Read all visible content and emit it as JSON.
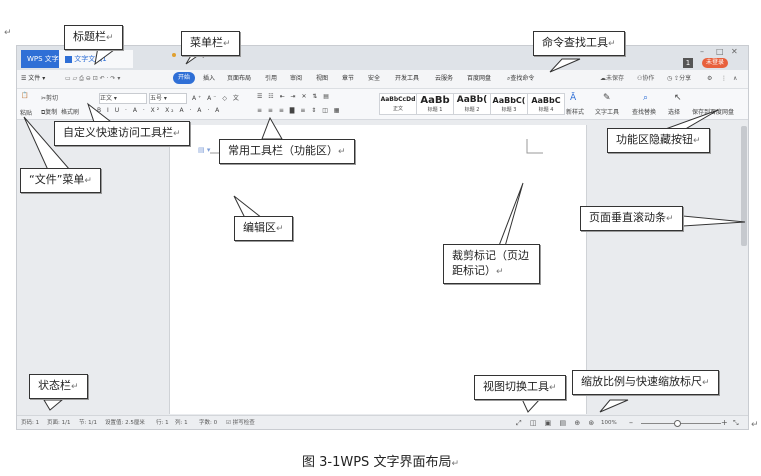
{
  "window": {
    "app_tab": "WPS 文字",
    "doc_tab": "文字文稿1",
    "login_btn": "未登录",
    "badge": "1"
  },
  "menubar": {
    "file_menu": "文件",
    "items": [
      "开始",
      "插入",
      "页面布局",
      "引用",
      "审阅",
      "视图",
      "章节",
      "安全",
      "开发工具",
      "云服务",
      "百度网盘"
    ],
    "search_label": "查找命令",
    "right_items": [
      "未保存",
      "协作",
      "分享"
    ]
  },
  "ribbon": {
    "paste": "粘贴",
    "cut": "剪切",
    "copy": "复制",
    "format_painter": "格式刷",
    "font_name": "正文",
    "font_size": "五号",
    "styles": [
      {
        "sample": "AaBbCcDd",
        "label": "正文"
      },
      {
        "sample": "AaBb",
        "label": "标题 1"
      },
      {
        "sample": "AaBb(",
        "label": "标题 2"
      },
      {
        "sample": "AaBbC(",
        "label": "标题 3"
      },
      {
        "sample": "AaBbC",
        "label": "标题 4"
      }
    ],
    "new_style": "新样式",
    "text_tool": "文字工具",
    "find_replace": "查找替换",
    "select": "选择",
    "save_cloud": "保存到百度网盘"
  },
  "statusbar": {
    "page_num": "页码: 1",
    "pages": "页面: 1/1",
    "section": "节: 1/1",
    "setting": "设置值: 2.5厘米",
    "row": "行: 1",
    "col": "列: 1",
    "words": "字数: 0",
    "spell": "拼写检查",
    "zoom": "100%"
  },
  "callouts": {
    "title_bar": "标题栏",
    "menu_bar": "菜单栏",
    "cmd_search": "命令查找工具",
    "quick_access": "自定义快速访问工具栏",
    "ribbon": "常用工具栏（功能区）",
    "ribbon_hide": "功能区隐藏按钮",
    "file_menu": "“文件”菜单",
    "edit_area": "编辑区",
    "crop_mark": "裁剪标记（页边距标记）",
    "vscroll": "页面垂直滚动条",
    "status_bar": "状态栏",
    "view_switch": "视图切换工具",
    "zoom": "缩放比例与快速缩放标尺"
  },
  "caption": "图 3-1WPS 文字界面布局",
  "colors": {
    "accent": "#2f6fd6",
    "login": "#e8603c"
  }
}
